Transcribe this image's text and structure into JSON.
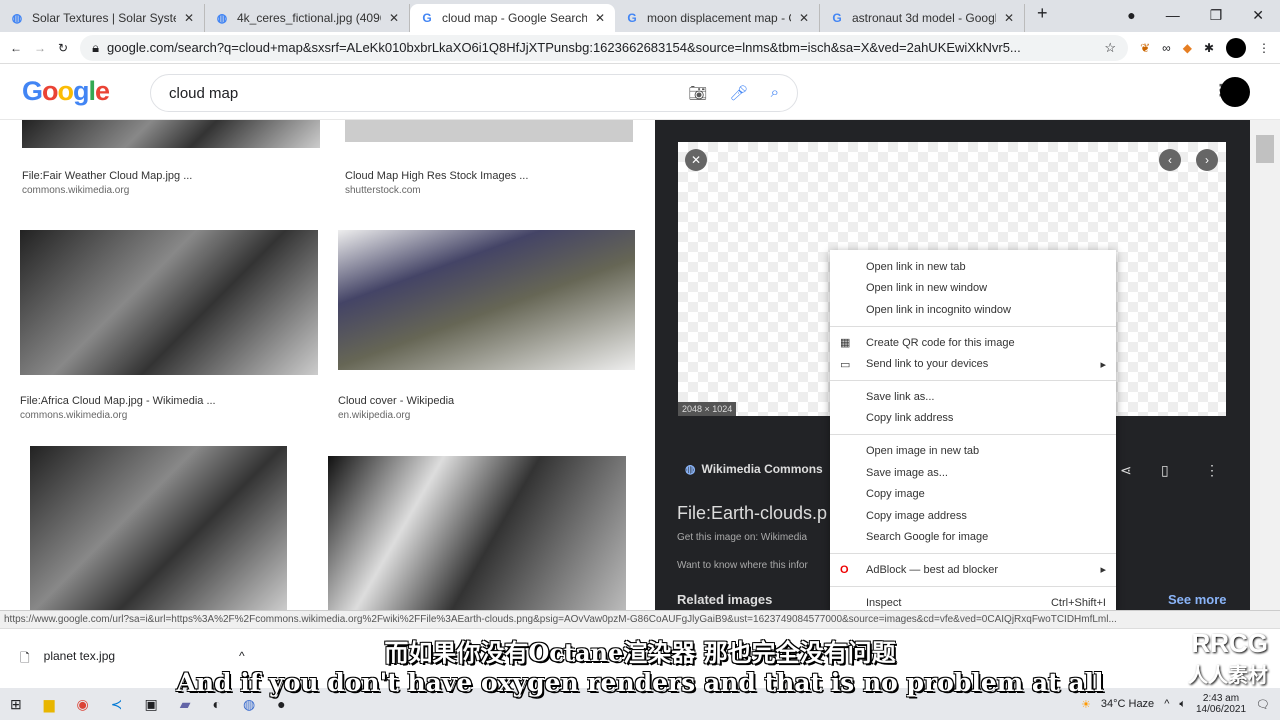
{
  "tabs": [
    {
      "title": "Solar Textures | Solar System",
      "icon": "globe-icon"
    },
    {
      "title": "4k_ceres_fictional.jpg (4096×",
      "icon": "globe-icon"
    },
    {
      "title": "cloud map - Google Search",
      "icon": "google-icon",
      "active": true
    },
    {
      "title": "moon displacement map - G",
      "icon": "google-icon"
    },
    {
      "title": "astronaut 3d model - Google",
      "icon": "google-icon"
    }
  ],
  "address": "google.com/search?q=cloud+map&sxsrf=ALeKk010bxbrLkaXO6i1Q8HfJjXTPunsbg:1623662683154&source=lnms&tbm=isch&sa=X&ved=2ahUKEwiXkNvr5...",
  "google": {
    "logo": "Google",
    "query": "cloud map"
  },
  "results": [
    {
      "title": "File:Fair Weather Cloud Map.jpg ...",
      "source": "commons.wikimedia.org"
    },
    {
      "title": "Cloud Map High Res Stock Images ...",
      "source": "shutterstock.com"
    },
    {
      "title": "File:Africa Cloud Map.jpg - Wikimedia ...",
      "source": "commons.wikimedia.org"
    },
    {
      "title": "Cloud cover - Wikipedia",
      "source": "en.wikipedia.org"
    }
  ],
  "panel": {
    "dimensions": "2048 × 1024",
    "site": "Wikimedia Commons",
    "title": "File:Earth-clouds.p",
    "get_image": "Get this image on: Wikimedia",
    "want_to_know": "Want to know where this infor",
    "related": "Related images",
    "see_more": "See more"
  },
  "context_menu": {
    "groups": [
      [
        "Open link in new tab",
        "Open link in new window",
        "Open link in incognito window"
      ],
      [
        "Create QR code for this image",
        "Send link to your devices"
      ],
      [
        "Save link as...",
        "Copy link address"
      ],
      [
        "Open image in new tab",
        "Save image as...",
        "Copy image",
        "Copy image address",
        "Search Google for image"
      ],
      [
        "AdBlock — best ad blocker"
      ],
      [
        "Inspect"
      ]
    ],
    "inspect_shortcut": "Ctrl+Shift+I"
  },
  "status_url": "https://www.google.com/url?sa=i&url=https%3A%2F%2Fcommons.wikimedia.org%2Fwiki%2FFile%3AEarth-clouds.png&psig=AOvVaw0pzM-G86CoAUFgJlyGaiB9&ust=1623749084577000&source=images&cd=vfe&ved=0CAIQjRxqFwoTCIDHmfLml...",
  "download": {
    "file": "planet tex.jpg"
  },
  "subtitles": {
    "zh": "而如果你没有Octane渲染器 那也完全没有问题",
    "en": "And if you don't have oxygen renders and that is no problem at all"
  },
  "watermark": {
    "brand": "RRCG",
    "cn": "人人素材"
  },
  "taskbar": {
    "weather": "34°C  Haze",
    "time": "2:43 am",
    "date": "14/06/2021"
  }
}
